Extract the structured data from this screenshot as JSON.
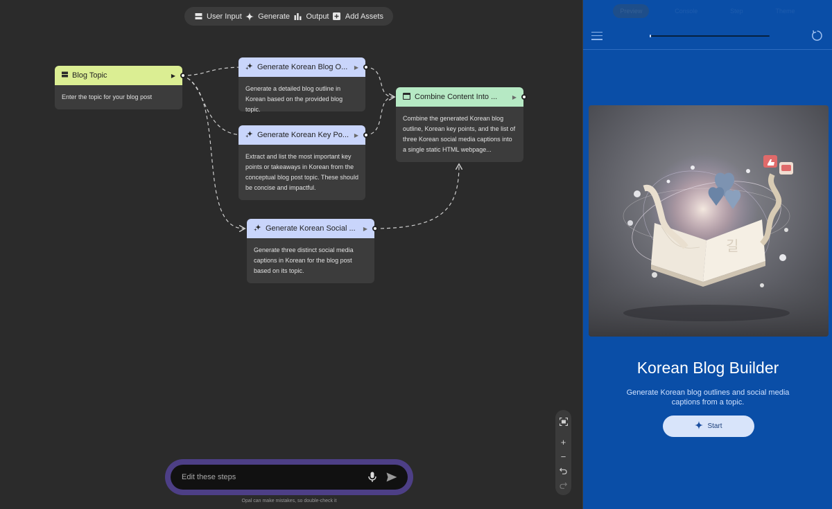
{
  "toolbar": {
    "user_input": "User Input",
    "generate": "Generate",
    "output": "Output",
    "add_assets": "Add Assets"
  },
  "nodes": {
    "blog_topic": {
      "title": "Blog Topic",
      "body": "Enter the topic for your blog post",
      "icon": "input-icon",
      "color": "#dbee93"
    },
    "outline": {
      "title": "Generate Korean Blog O...",
      "body": "Generate a detailed blog outline in Korean based on the provided blog topic.",
      "icon": "sparkle-icon",
      "color": "#c9d5fb"
    },
    "key_points": {
      "title": "Generate Korean Key Po...",
      "body": "Extract and list the most important key points or takeaways in Korean from the conceptual blog post topic. These should be concise and impactful.",
      "icon": "sparkle-icon",
      "color": "#c9d5fb"
    },
    "social": {
      "title": "Generate Korean Social ...",
      "body": "Generate three distinct social media captions in Korean for the blog post based on its topic.",
      "icon": "sparkle-icon",
      "color": "#c9d5fb"
    },
    "combine": {
      "title": "Combine Content Into ...",
      "body": "Combine the generated Korean blog outline, Korean key points, and the list of three Korean social media captions into a single static HTML webpage...",
      "icon": "webpage-icon",
      "color": "#b6e9c4"
    }
  },
  "edit_bar": {
    "placeholder": "Edit these steps",
    "disclaimer": "Opal can make mistakes, so double-check it"
  },
  "preview": {
    "tabs": [
      "Preview",
      "Console",
      "Step",
      "Theme"
    ],
    "active_tab": "Preview",
    "progress": 0.01,
    "title": "Korean Blog Builder",
    "subtitle": "Generate Korean blog outlines and social media captions from a topic.",
    "start_label": "Start",
    "accent": "#0a4ea7"
  }
}
